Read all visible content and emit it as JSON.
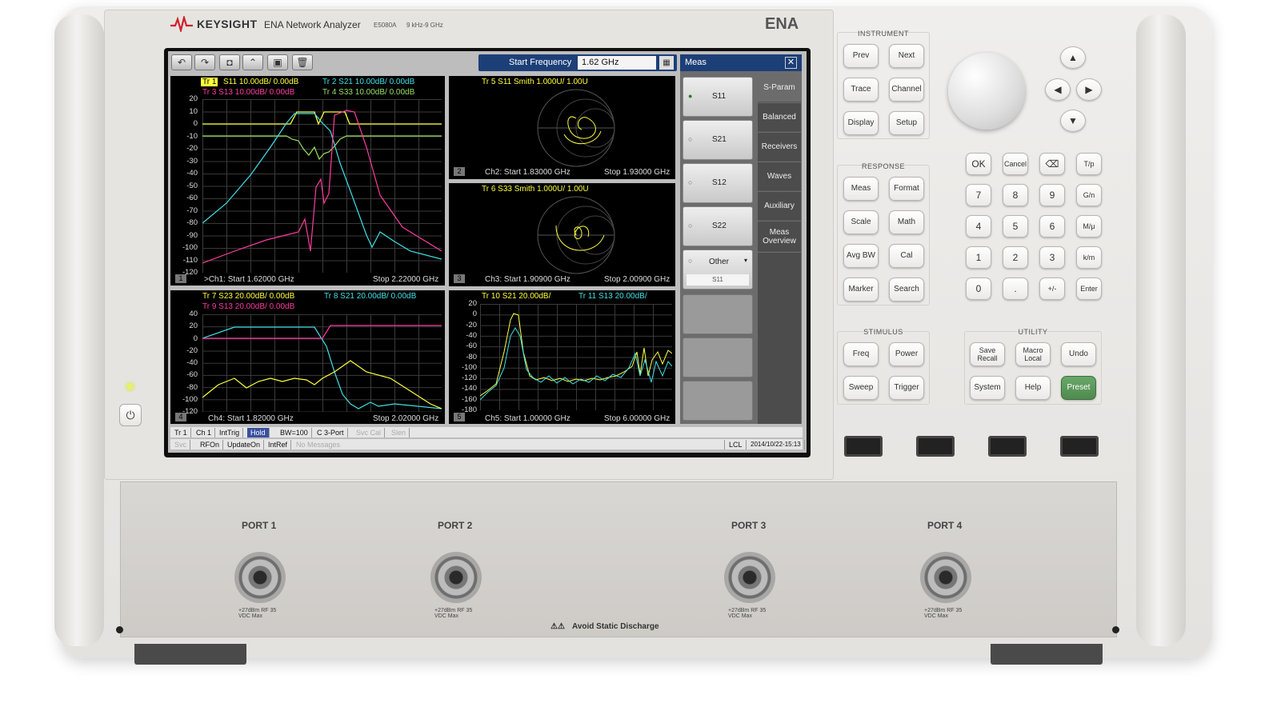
{
  "header": {
    "brand": "KEYSIGHT",
    "product": "ENA Network Analyzer",
    "model": "E5080A",
    "range": "9 kHz-9 GHz",
    "ena_label": "ENA"
  },
  "toolbar": {
    "start_freq_label": "Start Frequency",
    "start_freq_value": "1.62 GHz"
  },
  "meas_panel": {
    "title": "Meas",
    "buttons": [
      "S11",
      "S21",
      "S12",
      "S22"
    ],
    "other_label": "Other",
    "other_sub": "S11",
    "tabs": [
      "S-Param",
      "Balanced",
      "Receivers",
      "Waves",
      "Auxiliary",
      "Meas Overview"
    ]
  },
  "ch1": {
    "tr1_id": "Tr 1",
    "tr1": "S11 10.00dB/  0.00dB",
    "tr2": "Tr  2  S21 10.00dB/  0.00dB",
    "tr3": "Tr  3   S13 10.00dB/  0.00dB",
    "tr4": "Tr  4   S33 10.00dB/  0.00dB",
    "num": "1",
    "start": ">Ch1:  Start  1.62000 GHz",
    "stop": "Stop  2.22000 GHz",
    "yticks": [
      "20",
      "10",
      "0",
      "-10",
      "-20",
      "-30",
      "-40",
      "-50",
      "-60",
      "-70",
      "-80",
      "-90",
      "-100",
      "-110",
      "-120"
    ]
  },
  "ch2": {
    "tr": "Tr  5   S11 Smith 1.000U/  1.00U",
    "num": "2",
    "start": "Ch2:  Start  1.83000 GHz",
    "stop": "Stop  1.93000 GHz"
  },
  "ch3": {
    "tr": "Tr  6   S33 Smith 1.000U/  1.00U",
    "num": "3",
    "start": "Ch3:  Start  1.90900 GHz",
    "stop": "Stop  2.00900 GHz"
  },
  "ch4": {
    "tr7": "Tr  7   S23 20.00dB/  0.00dB",
    "tr8": "Tr  8   S21 20.00dB/  0.00dB",
    "tr9": "Tr  9   S13 20.00dB/  0.00dB",
    "num": "4",
    "start": "Ch4:  Start  1.82000 GHz",
    "stop": "Stop  2.02000 GHz",
    "yticks": [
      "40",
      "20",
      "0",
      "-20",
      "-40",
      "-60",
      "-80",
      "-100",
      "-120"
    ]
  },
  "ch5": {
    "tr10": "Tr 10  S21 20.00dB/",
    "tr11": "Tr 11  S13 20.00dB/",
    "num": "5",
    "start": "Ch5:  Start  1.00000 GHz",
    "stop": "Stop  6.00000 GHz",
    "yticks": [
      "20",
      "0",
      "-20",
      "-40",
      "-60",
      "-80",
      "-100",
      "-120",
      "-140",
      "-160",
      "-180"
    ]
  },
  "status": {
    "row1": [
      "Tr 1",
      "Ch 1",
      "IntTrig",
      "Hold",
      "BW=100",
      "C  3-Port",
      "Svc Cal",
      "Slen"
    ],
    "row2": [
      "Svc",
      "RFOn",
      "UpdateOn",
      "IntRef",
      "No Messages"
    ],
    "lcl": "LCL",
    "datetime": "2014/10/22-15:13"
  },
  "panel": {
    "instrument": "INSTRUMENT",
    "response": "RESPONSE",
    "stimulus": "STIMULUS",
    "utility": "UTILITY",
    "inst_keys": [
      "Prev",
      "Next",
      "Trace",
      "Channel",
      "Display",
      "Setup"
    ],
    "resp_keys": [
      "Meas",
      "Format",
      "Scale",
      "Math",
      "Avg BW",
      "Cal",
      "Marker",
      "Search"
    ],
    "stim_keys": [
      "Freq",
      "Power",
      "Sweep",
      "Trigger"
    ],
    "util_keys": [
      "Save Recall",
      "Macro Local",
      "Undo",
      "System",
      "Help",
      "Preset"
    ],
    "entry_keys": [
      "OK",
      "Cancel",
      "⌫",
      "T/p",
      "7",
      "8",
      "9",
      "G/n",
      "4",
      "5",
      "6",
      "M/μ",
      "1",
      "2",
      "3",
      "k/m",
      "0",
      ".",
      "+/-",
      "Enter"
    ]
  },
  "ports": [
    {
      "label": "PORT 1"
    },
    {
      "label": "PORT 2"
    },
    {
      "label": "PORT 3"
    },
    {
      "label": "PORT 4"
    }
  ],
  "port_warning": "+27dBm RF 35 VDC Max",
  "static_warning": "Avoid Static Discharge",
  "colors": {
    "yellow": "#ffff3c",
    "cyan": "#40e0e8",
    "magenta": "#ff3ca0",
    "green": "#9ae060",
    "preset": "#5e9a5e"
  }
}
